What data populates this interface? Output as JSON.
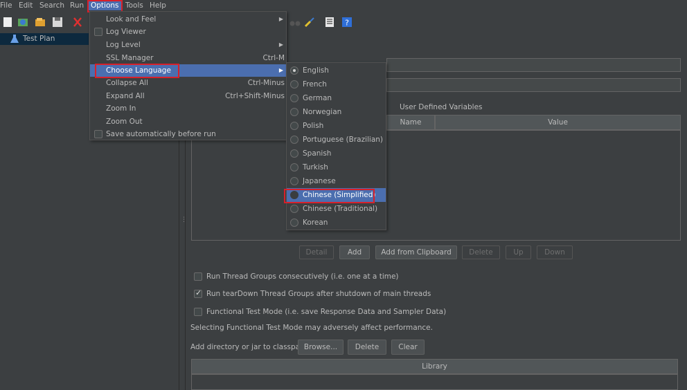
{
  "menubar": {
    "items": [
      "File",
      "Edit",
      "Search",
      "Run",
      "Options",
      "Tools",
      "Help"
    ]
  },
  "tree": {
    "root_label": "Test Plan"
  },
  "options_menu": {
    "items": [
      {
        "label": "Look and Feel",
        "shortcut": "",
        "submenu": true
      },
      {
        "label": "Log Viewer",
        "shortcut": "",
        "checkbox": true
      },
      {
        "label": "Log Level",
        "shortcut": "",
        "submenu": true
      },
      {
        "label": "SSL Manager",
        "shortcut": "Ctrl-M"
      },
      {
        "label": "Choose Language",
        "shortcut": "",
        "submenu": true,
        "highlighted": true
      },
      {
        "label": "Collapse All",
        "shortcut": "Ctrl-Minus"
      },
      {
        "label": "Expand All",
        "shortcut": "Ctrl+Shift-Minus"
      },
      {
        "label": "Zoom In",
        "shortcut": ""
      },
      {
        "label": "Zoom Out",
        "shortcut": ""
      },
      {
        "label": "Save automatically before run",
        "shortcut": "",
        "checkbox": true
      }
    ]
  },
  "language_menu": {
    "items": [
      "English",
      "French",
      "German",
      "Norwegian",
      "Polish",
      "Portuguese (Brazilian)",
      "Spanish",
      "Turkish",
      "Japanese",
      "Chinese (Simplified)",
      "Chinese (Traditional)",
      "Korean"
    ],
    "selected": "English",
    "highlighted": "Chinese (Simplified)"
  },
  "main": {
    "udv_title": "User Defined Variables",
    "udv_columns": [
      "Name",
      "Value"
    ],
    "udv_buttons": [
      "Detail",
      "Add",
      "Add from Clipboard",
      "Delete",
      "Up",
      "Down"
    ],
    "checkboxes": [
      {
        "label": "Run Thread Groups consecutively (i.e. one at a time)",
        "checked": false
      },
      {
        "label": "Run tearDown Thread Groups after shutdown of main threads",
        "checked": true
      },
      {
        "label": "Functional Test Mode (i.e. save Response Data and Sampler Data)",
        "checked": false
      }
    ],
    "functional_note": "Selecting Functional Test Mode may adversely affect performance.",
    "classpath_label": "Add directory or jar to classpath",
    "classpath_buttons": [
      "Browse...",
      "Delete",
      "Clear"
    ],
    "library_column": "Library"
  },
  "colors": {
    "background": "#3c3f41",
    "highlight": "#4b6eaf",
    "annotation_red": "#d8202a"
  }
}
